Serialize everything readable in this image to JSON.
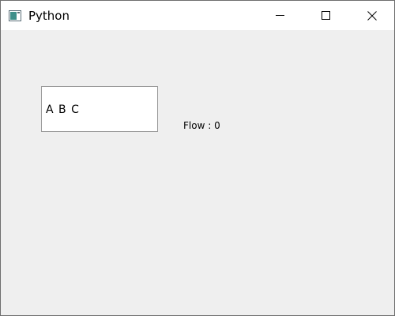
{
  "window": {
    "title": "Python",
    "icon": "python-app-icon",
    "controls": {
      "minimize_icon": "minimize-icon",
      "maximize_icon": "maximize-icon",
      "close_icon": "close-icon"
    }
  },
  "main": {
    "textbox_value": "A B C",
    "flow_label": "Flow : 0"
  },
  "colors": {
    "titlebar": "#ffffff",
    "client": "#efefef",
    "textbox_bg": "#ffffff",
    "textbox_border": "#9a9a9a"
  }
}
